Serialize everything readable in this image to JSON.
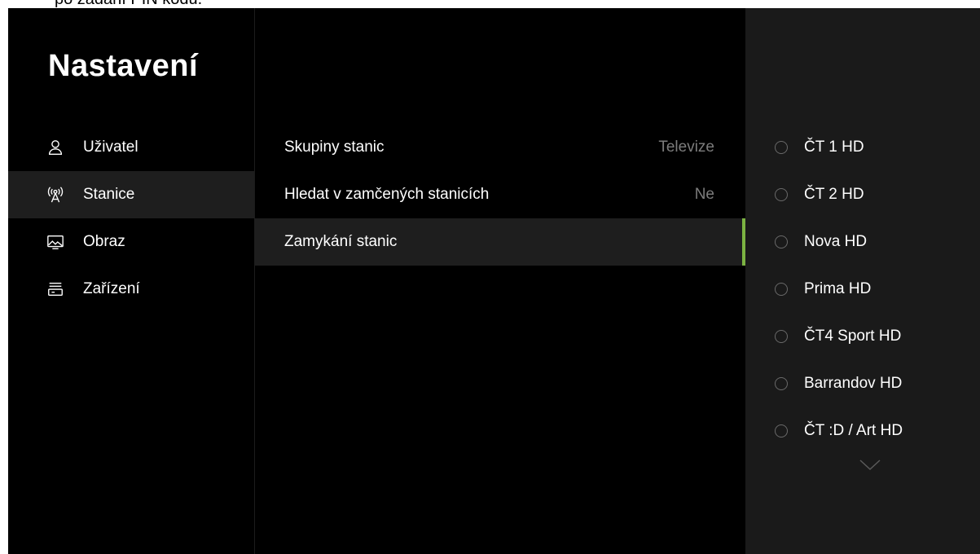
{
  "caption": "po zadání PIN kódu.",
  "nav": {
    "title": "Nastavení",
    "items": [
      {
        "label": "Uživatel",
        "icon": "user-icon"
      },
      {
        "label": "Stanice",
        "icon": "antenna-icon"
      },
      {
        "label": "Obraz",
        "icon": "picture-icon"
      },
      {
        "label": "Zařízení",
        "icon": "device-icon"
      }
    ],
    "active_index": 1
  },
  "settings": {
    "rows": [
      {
        "label": "Skupiny stanic",
        "value": "Televize"
      },
      {
        "label": "Hledat v zamčených stanicích",
        "value": "Ne"
      },
      {
        "label": "Zamykání stanic",
        "value": ""
      }
    ],
    "active_index": 2
  },
  "stations": {
    "items": [
      {
        "name": "ČT 1 HD",
        "checked": false
      },
      {
        "name": "ČT 2 HD",
        "checked": false
      },
      {
        "name": "Nova HD",
        "checked": false
      },
      {
        "name": "Prima HD",
        "checked": false
      },
      {
        "name": "ČT4 Sport HD",
        "checked": false
      },
      {
        "name": "Barrandov HD",
        "checked": false
      },
      {
        "name": "ČT :D / Art HD",
        "checked": false
      }
    ],
    "more_icon": "chevron-down-icon"
  },
  "colors": {
    "background": "#000000",
    "active_row": "#1e1e1e",
    "right_panel": "#1a1a1a",
    "accent": "#7cb342",
    "muted_text": "#7c7c7c"
  }
}
